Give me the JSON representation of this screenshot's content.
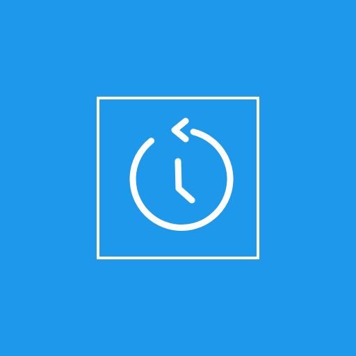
{
  "app_tile": {
    "background_color": "#1E98EA",
    "foreground_color": "#FFFFFF",
    "icon": "clock-history-icon"
  }
}
